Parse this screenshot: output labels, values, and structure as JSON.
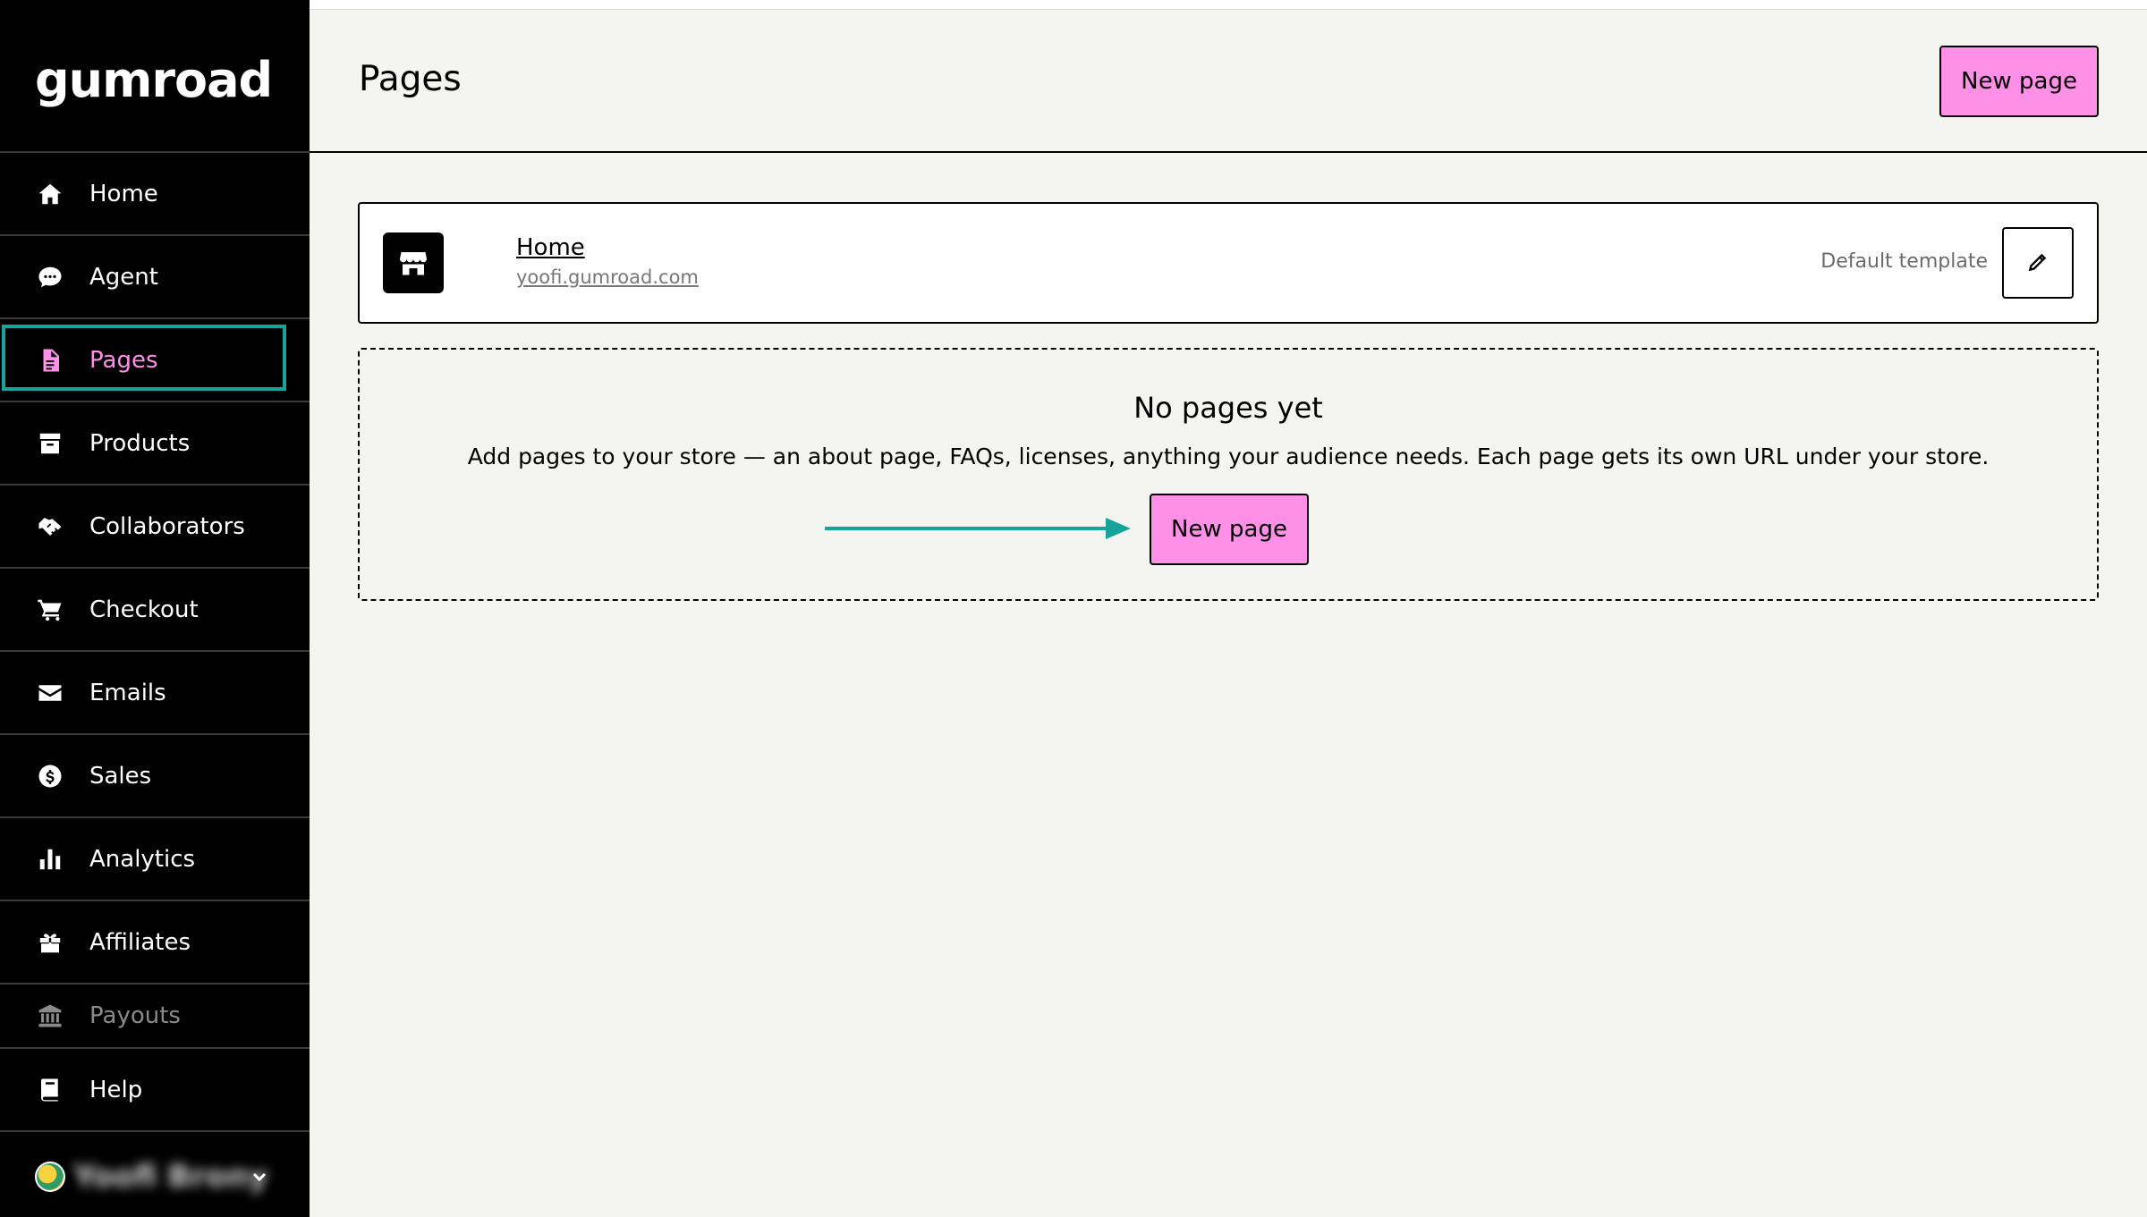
{
  "brand": {
    "logo_text": "Gumroad",
    "accent": "#ff90e8",
    "focus_ring": "#16a39a",
    "arrow": "#16a39a"
  },
  "sidebar": {
    "items": [
      {
        "label": "Home",
        "icon": "home-icon"
      },
      {
        "label": "Agent",
        "icon": "chat-bubble-icon"
      },
      {
        "label": "Pages",
        "icon": "document-icon",
        "active": true
      },
      {
        "label": "Products",
        "icon": "archive-box-icon"
      },
      {
        "label": "Collaborators",
        "icon": "handshake-icon"
      },
      {
        "label": "Checkout",
        "icon": "cart-icon"
      },
      {
        "label": "Emails",
        "icon": "envelope-icon"
      },
      {
        "label": "Sales",
        "icon": "dollar-circle-icon"
      },
      {
        "label": "Analytics",
        "icon": "bar-chart-icon"
      },
      {
        "label": "Affiliates",
        "icon": "gift-icon"
      },
      {
        "label": "Payouts",
        "icon": "bank-icon"
      },
      {
        "label": "Help",
        "icon": "book-icon"
      }
    ],
    "account": {
      "name": "Yoofi Brony"
    }
  },
  "header": {
    "title": "Pages",
    "new_page_label": "New page"
  },
  "page_card": {
    "title": "Home",
    "url": "yoofi.gumroad.com",
    "template_label": "Default template"
  },
  "empty_state": {
    "title": "No pages yet",
    "text": "Add pages to your store — an about page, FAQs, licenses, anything your audience needs. Each page gets its own URL under your store.",
    "button_label": "New page"
  }
}
